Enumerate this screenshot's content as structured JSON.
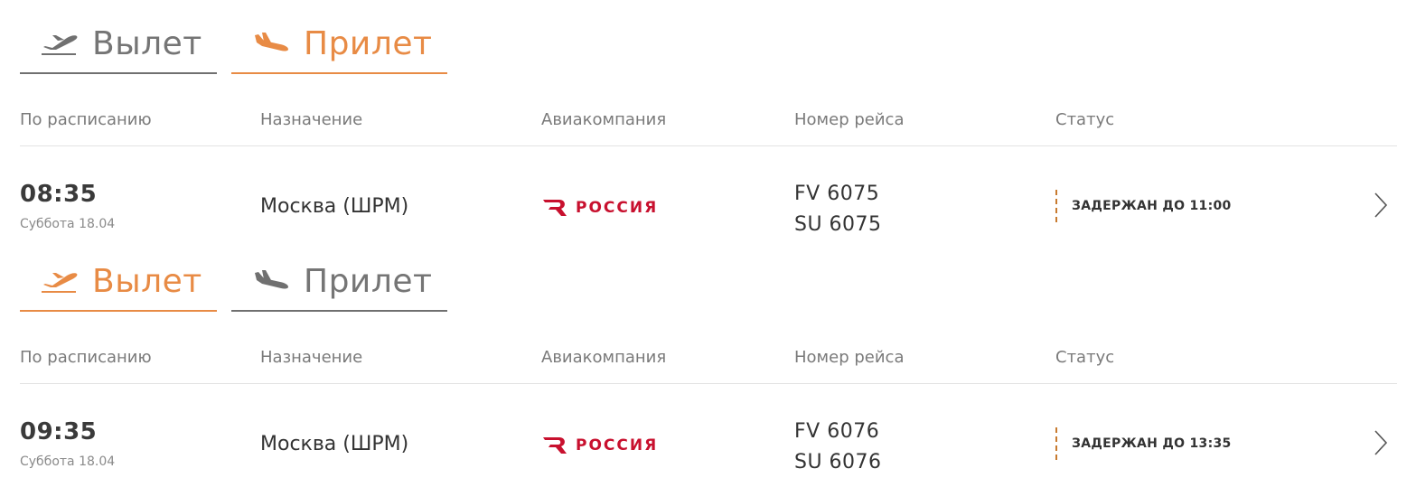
{
  "boards": [
    {
      "tabs": {
        "departure": "Вылет",
        "arrival": "Прилет",
        "active": "arrival"
      },
      "headers": {
        "scheduled": "По расписанию",
        "destination": "Назначение",
        "airline": "Авиакомпания",
        "flight_number": "Номер рейса",
        "status": "Статус"
      },
      "row": {
        "time": "08:35",
        "date": "Суббота 18.04",
        "destination": "Москва (ШРМ)",
        "airline_name": "РОССИЯ",
        "flights": [
          "FV 6075",
          "SU 6075"
        ],
        "status": "ЗАДЕРЖАН ДО 11:00"
      }
    },
    {
      "tabs": {
        "departure": "Вылет",
        "arrival": "Прилет",
        "active": "departure"
      },
      "headers": {
        "scheduled": "По расписанию",
        "destination": "Назначение",
        "airline": "Авиакомпания",
        "flight_number": "Номер рейса",
        "status": "Статус"
      },
      "row": {
        "time": "09:35",
        "date": "Суббота 18.04",
        "destination": "Москва (ШРМ)",
        "airline_name": "РОССИЯ",
        "flights": [
          "FV 6076",
          "SU 6076"
        ],
        "status": "ЗАДЕРЖАН ДО 13:35"
      }
    }
  ],
  "colors": {
    "accent": "#e88b45",
    "inactive": "#707070",
    "airline_brand": "#c8102e",
    "status_marker": "#c87a2e"
  },
  "icons": {
    "departure_tab": "plane-takeoff-icon",
    "arrival_tab": "plane-landing-icon",
    "row_chevron": "chevron-right-icon",
    "airline": "rossiya-logo-icon"
  }
}
